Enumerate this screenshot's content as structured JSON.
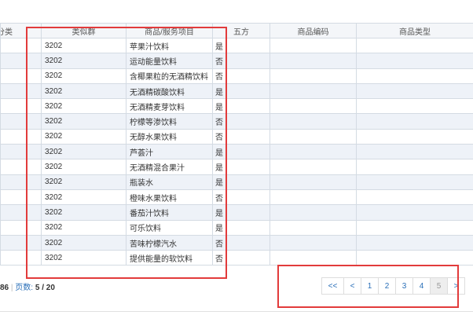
{
  "table": {
    "headers": [
      "分类",
      "类似群",
      "商品/服务项目",
      "五方",
      "商品编码",
      "商品类型"
    ],
    "rows": [
      {
        "group": "3202",
        "item": "苹果汁饮料",
        "flag": "是"
      },
      {
        "group": "3202",
        "item": "运动能量饮料",
        "flag": "否"
      },
      {
        "group": "3202",
        "item": "含椰果粒的无酒精饮料",
        "flag": "否"
      },
      {
        "group": "3202",
        "item": "无酒精碳酸饮料",
        "flag": "是"
      },
      {
        "group": "3202",
        "item": "无酒精麦芽饮料",
        "flag": "是"
      },
      {
        "group": "3202",
        "item": "柠檬等渗饮料",
        "flag": "否"
      },
      {
        "group": "3202",
        "item": "无醇水果饮料",
        "flag": "否"
      },
      {
        "group": "3202",
        "item": "芦荟汁",
        "flag": "是"
      },
      {
        "group": "3202",
        "item": "无酒精混合果汁",
        "flag": "是"
      },
      {
        "group": "3202",
        "item": "瓶装水",
        "flag": "是"
      },
      {
        "group": "3202",
        "item": "橙味水果饮料",
        "flag": "否"
      },
      {
        "group": "3202",
        "item": "番茄汁饮料",
        "flag": "是"
      },
      {
        "group": "3202",
        "item": "可乐饮料",
        "flag": "是"
      },
      {
        "group": "3202",
        "item": "苦味柠檬汽水",
        "flag": "否"
      },
      {
        "group": "3202",
        "item": "提供能量的软饮料",
        "flag": "否"
      }
    ]
  },
  "footer": {
    "count_fragment": "86",
    "separator": "|",
    "pages_label": "页数:",
    "pages_value": "5 / 20"
  },
  "pagination": {
    "first": "<<",
    "prev": "<",
    "pages": [
      "1",
      "2",
      "3",
      "4",
      "5"
    ],
    "current": "5",
    "next": ">"
  }
}
